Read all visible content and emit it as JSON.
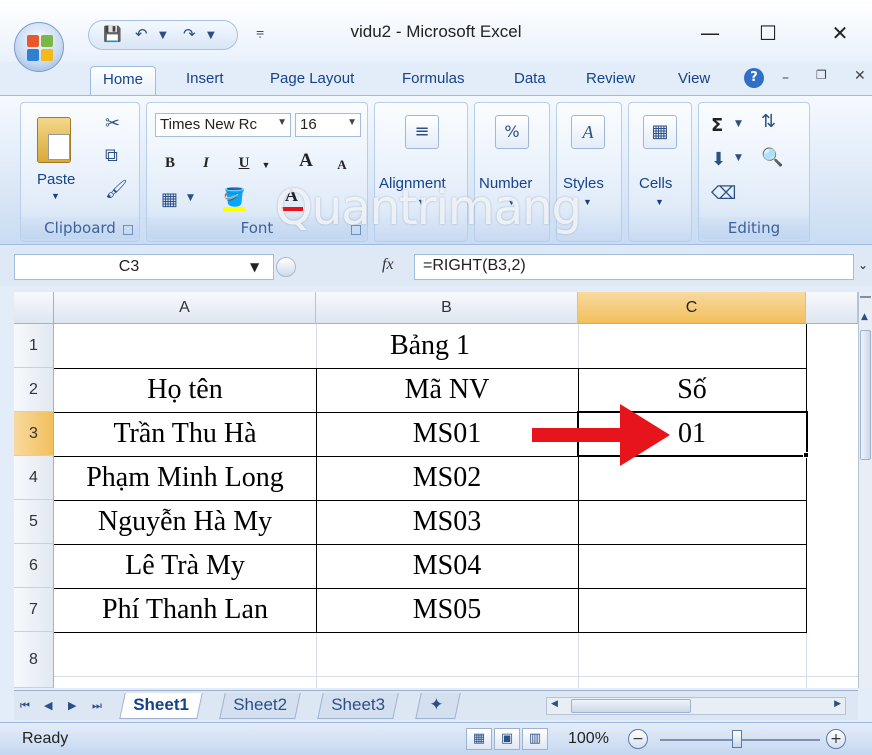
{
  "window": {
    "title": "vidu2 - Microsoft Excel",
    "minimize": "—",
    "maximize": "☐",
    "close": "✕"
  },
  "ribbon_tabs": [
    "Home",
    "Insert",
    "Page Layout",
    "Formulas",
    "Data",
    "Review",
    "View"
  ],
  "help_icon": "?",
  "ribbon": {
    "clipboard": {
      "label": "Clipboard",
      "paste": "Paste"
    },
    "font": {
      "label": "Font",
      "name": "Times New Roman",
      "name_shown": "Times New Rc",
      "size": "16",
      "bold": "B",
      "italic": "I",
      "underline": "U",
      "grow": "A",
      "shrink": "A"
    },
    "alignment": {
      "label": "Alignment"
    },
    "number": {
      "label": "Number",
      "icon_text": "%"
    },
    "styles": {
      "label": "Styles"
    },
    "cells": {
      "label": "Cells"
    },
    "editing": {
      "label": "Editing"
    }
  },
  "watermark": "Quantrimang",
  "formula_bar": {
    "name_box": "C3",
    "fx": "fx",
    "formula": "=RIGHT(B3,2)"
  },
  "sheet": {
    "columns": [
      "A",
      "B",
      "C"
    ],
    "rows": [
      "1",
      "2",
      "3",
      "4",
      "5",
      "6",
      "7",
      "8"
    ],
    "selected_cell": "C3",
    "title": "Bảng 1",
    "headers": [
      "Họ tên",
      "Mã NV",
      "Số"
    ],
    "data": [
      [
        "Trần Thu Hà",
        "MS01",
        "01"
      ],
      [
        "Phạm Minh Long",
        "MS02",
        ""
      ],
      [
        "Nguyễn Hà My",
        "MS03",
        ""
      ],
      [
        "Lê Trà My",
        "MS04",
        ""
      ],
      [
        "Phí Thanh Lan",
        "MS05",
        ""
      ]
    ],
    "arrow_color": "#e8141b"
  },
  "sheet_tabs": [
    "Sheet1",
    "Sheet2",
    "Sheet3"
  ],
  "active_sheet": "Sheet1",
  "status": {
    "text": "Ready",
    "zoom": "100%"
  }
}
